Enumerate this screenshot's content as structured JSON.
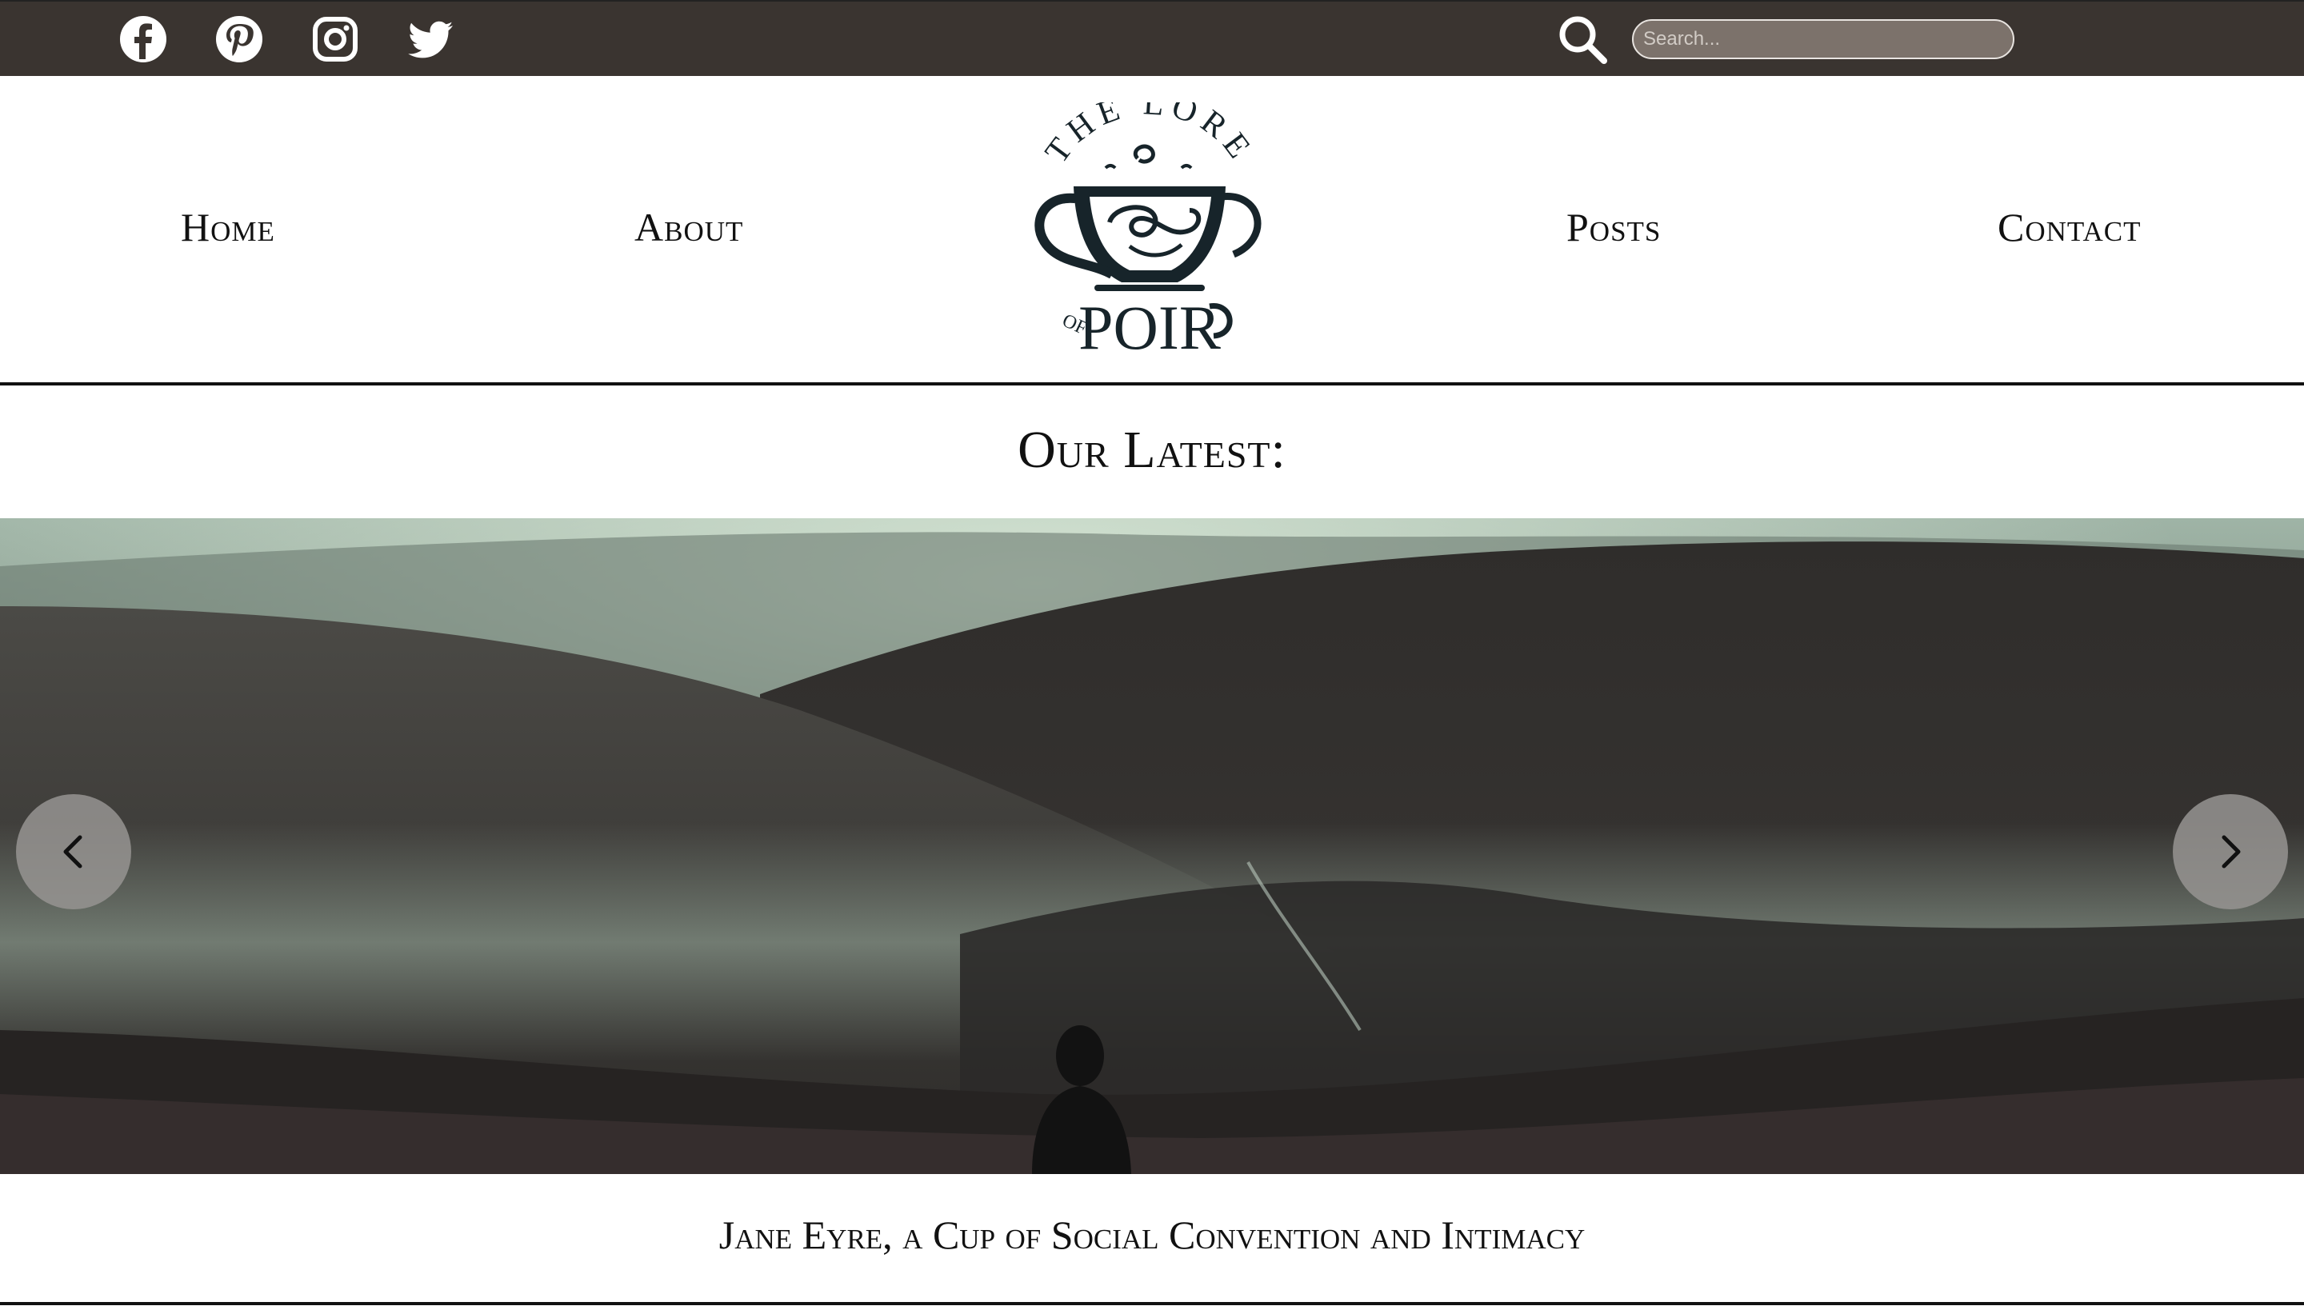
{
  "topbar": {
    "social": [
      {
        "name": "facebook-icon"
      },
      {
        "name": "pinterest-icon"
      },
      {
        "name": "instagram-icon"
      },
      {
        "name": "twitter-icon"
      }
    ],
    "search": {
      "placeholder": "Search..."
    },
    "colors": {
      "bar": "#3a3430",
      "search_field": "#7c726b"
    }
  },
  "nav": {
    "home": "Home",
    "about": "About",
    "posts": "Posts",
    "contact": "Contact"
  },
  "logo": {
    "top_text": "THE LORE",
    "of_text": "OF",
    "bottom_text": "POIR"
  },
  "latest": {
    "heading": "Our Latest:"
  },
  "carousel": {
    "prev_icon": "chevron-left-icon",
    "next_icon": "chevron-right-icon",
    "caption": "Jane Eyre, a Cup of Social Convention and Intimacy"
  }
}
